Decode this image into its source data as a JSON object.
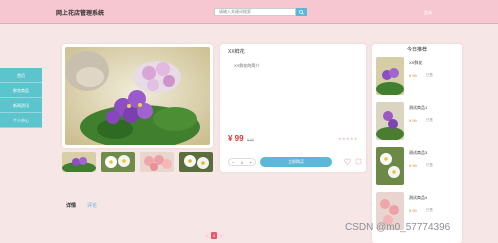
{
  "header": {
    "site_title": "网上花店管理系统",
    "search_placeholder": "请输入关键词搜索",
    "top_right_label": "登录"
  },
  "sidebar": {
    "items": [
      {
        "label": "首页"
      },
      {
        "label": "鲜花商品"
      },
      {
        "label": "新闻资讯"
      },
      {
        "label": "个人中心"
      }
    ]
  },
  "product": {
    "title": "XX鲜花",
    "description": "XX鲜花的简介",
    "price": "¥ 99",
    "old_price": "¥ 99",
    "rating_stars": "★★★★★",
    "quantity": "1",
    "qty_minus": "−",
    "qty_plus": "+",
    "add_to_cart_label": "立即购买"
  },
  "ranking": {
    "title": "今日推荐",
    "items": [
      {
        "name": "XX鲜花",
        "price": "¥ 99",
        "sales": "已售"
      },
      {
        "name": "测试商品1",
        "price": "¥ 99",
        "sales": "已售"
      },
      {
        "name": "测试商品3",
        "price": "¥ 99",
        "sales": "已售"
      },
      {
        "name": "测试商品4",
        "price": "¥ 99",
        "sales": "已售"
      }
    ]
  },
  "tabs": [
    {
      "label": "详情"
    },
    {
      "label": "评论"
    }
  ],
  "pagination": {
    "prev": "‹",
    "current": "1",
    "next": "›"
  },
  "watermark": "CSDN @m0_57774396",
  "colors": {
    "header_bg": "#f6c7d0",
    "page_bg": "#f7e6e6",
    "sidebar_bg": "#5cc4cc",
    "accent": "#5bb8d6",
    "price": "#d53636"
  }
}
